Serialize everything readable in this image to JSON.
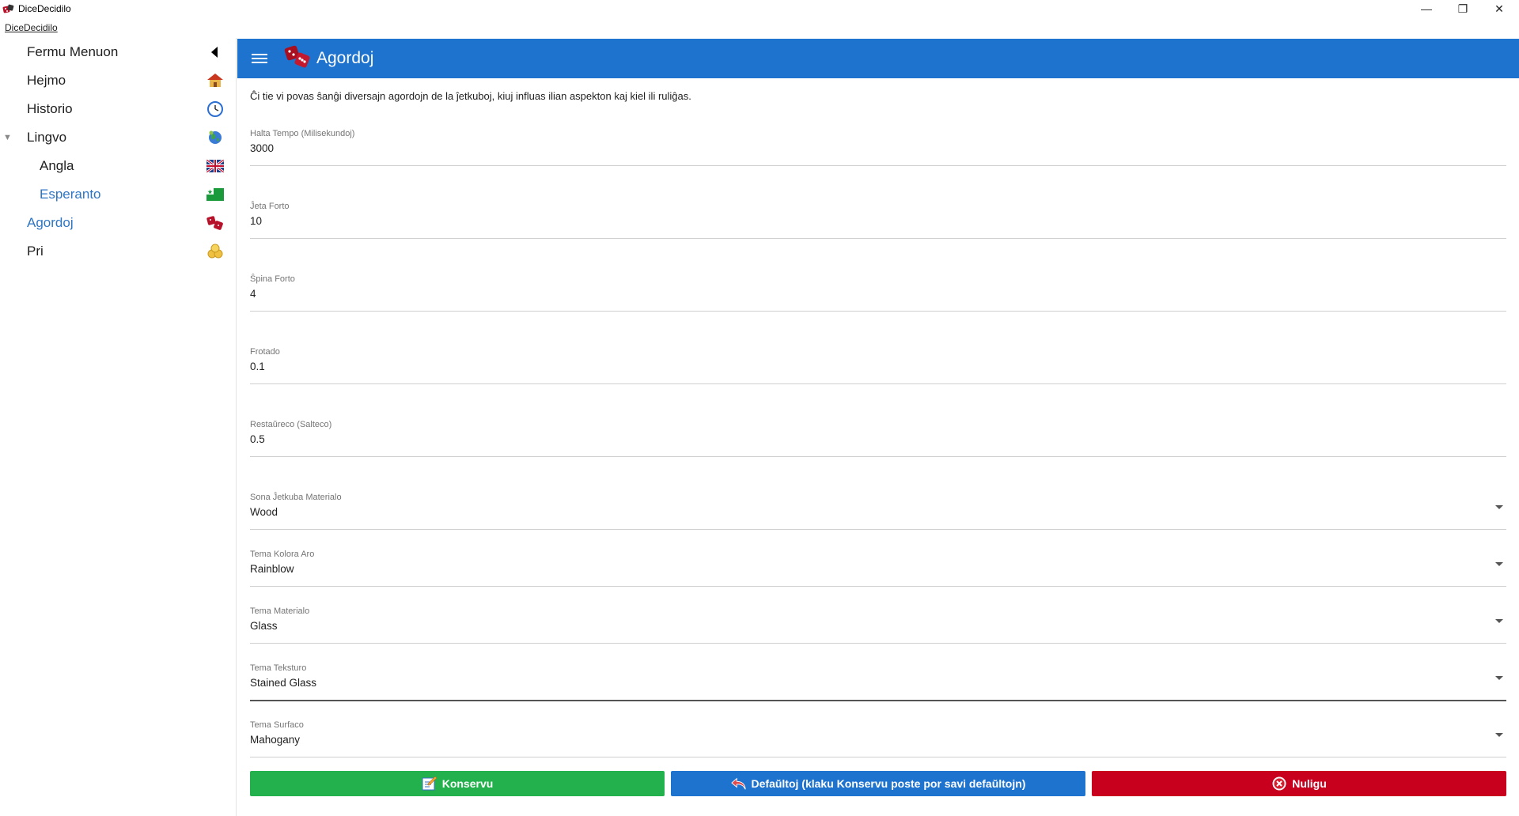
{
  "window": {
    "title": "DiceDecidilo",
    "subtitle": "DiceDecidilo",
    "minimize": "—",
    "restore": "❐",
    "close": "✕"
  },
  "sidebar": {
    "items": [
      {
        "label": "Fermu Menuon",
        "icon": "caret-left-icon"
      },
      {
        "label": "Hejmo",
        "icon": "home-icon"
      },
      {
        "label": "Historio",
        "icon": "clock-icon"
      },
      {
        "label": "Lingvo",
        "icon": "globe-icon"
      },
      {
        "label": "Angla",
        "icon": "uk-flag-icon"
      },
      {
        "label": "Esperanto",
        "icon": "esperanto-flag-icon"
      },
      {
        "label": "Agordoj",
        "icon": "dice-icon"
      },
      {
        "label": "Pri",
        "icon": "info-icon"
      }
    ]
  },
  "header": {
    "title": "Agordoj"
  },
  "main": {
    "description": "Ĉi tie vi povas ŝanĝi diversajn agordojn de la ĵetkuboj, kiuj influas ilian aspekton kaj kiel ili ruliĝas.",
    "fields": [
      {
        "label": "Halta Tempo (Milisekundoj)",
        "value": "3000"
      },
      {
        "label": "Ĵeta Forto",
        "value": "10"
      },
      {
        "label": "Ŝpina Forto",
        "value": "4"
      },
      {
        "label": "Frotado",
        "value": "0.1"
      },
      {
        "label": "Restaŭreco (Salteco)",
        "value": "0.5"
      },
      {
        "label": "Sona Ĵetkuba Materialo",
        "value": "Wood"
      },
      {
        "label": "Tema Kolora Aro",
        "value": "Rainblow"
      },
      {
        "label": "Tema Materialo",
        "value": "Glass"
      },
      {
        "label": "Tema Teksturo",
        "value": "Stained Glass"
      },
      {
        "label": "Tema Surfaco",
        "value": "Mahogany"
      }
    ],
    "buttons": {
      "save": "Konservu",
      "defaults": "Defaŭltoj (klaku Konservu poste por savi defaŭltojn)",
      "cancel": "Nuligu"
    }
  },
  "colors": {
    "accent": "#1e73cf",
    "save": "#22b14c",
    "defaults": "#1e73cf",
    "cancel": "#c8001e"
  }
}
